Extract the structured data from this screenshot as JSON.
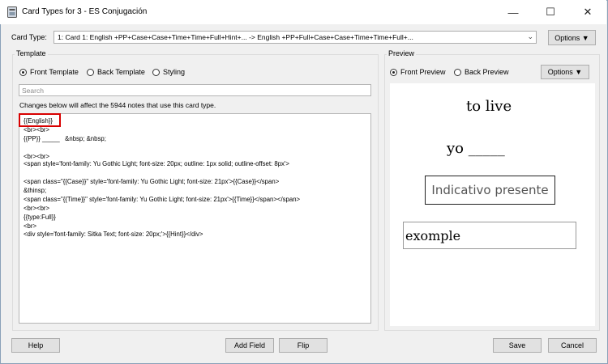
{
  "window": {
    "title": "Card Types for 3 - ES Conjugación",
    "minimize_glyph": "—",
    "maximize_glyph": "☐",
    "close_glyph": "✕"
  },
  "card_type": {
    "label": "Card Type:",
    "selected": "1: Card 1: English +PP+Case+Case+Time+Time+Full+Hint+... -> English +PP+Full+Case+Case+Time+Time+Full+...",
    "options_label": "Options ▼"
  },
  "template": {
    "group_title": "Template",
    "radios": [
      {
        "label": "Front Template",
        "checked": true
      },
      {
        "label": "Back Template",
        "checked": false
      },
      {
        "label": "Styling",
        "checked": false
      }
    ],
    "search_placeholder": "Search",
    "notice": "Changes below will affect the 5944 notes that use this card type.",
    "code_lines": [
      "{{English}}",
      "<br><br>",
      "{{PP}} _____   &nbsp; &nbsp;",
      "",
      "<br><br>",
      "<span style='font-family: Yu Gothic Light; font-size: 20px; outline: 1px solid; outline-offset: 8px'>",
      "",
      "<span class=\"{{Case}}\" style='font-family: Yu Gothic Light; font-size: 21px'>{{Case}}</span>",
      "&thinsp;",
      "<span class=\"{{Time}}\" style='font-family: Yu Gothic Light; font-size: 21px'>{{Time}}</span></span>",
      "<br><br>",
      "{{type:Full}}",
      "<br>",
      "<div style='font-family: Sitka Text; font-size: 20px;'>{{Hint}}</div>"
    ]
  },
  "preview": {
    "group_title": "Preview",
    "radios": [
      {
        "label": "Front Preview",
        "checked": true
      },
      {
        "label": "Back Preview",
        "checked": false
      }
    ],
    "options_label": "Options ▼",
    "english": "to live",
    "pp_line": "yo _____",
    "case_time": "Indicativo  presente",
    "hint": "exomple"
  },
  "buttons": {
    "help": "Help",
    "add_field": "Add Field",
    "flip": "Flip",
    "save": "Save",
    "cancel": "Cancel"
  }
}
